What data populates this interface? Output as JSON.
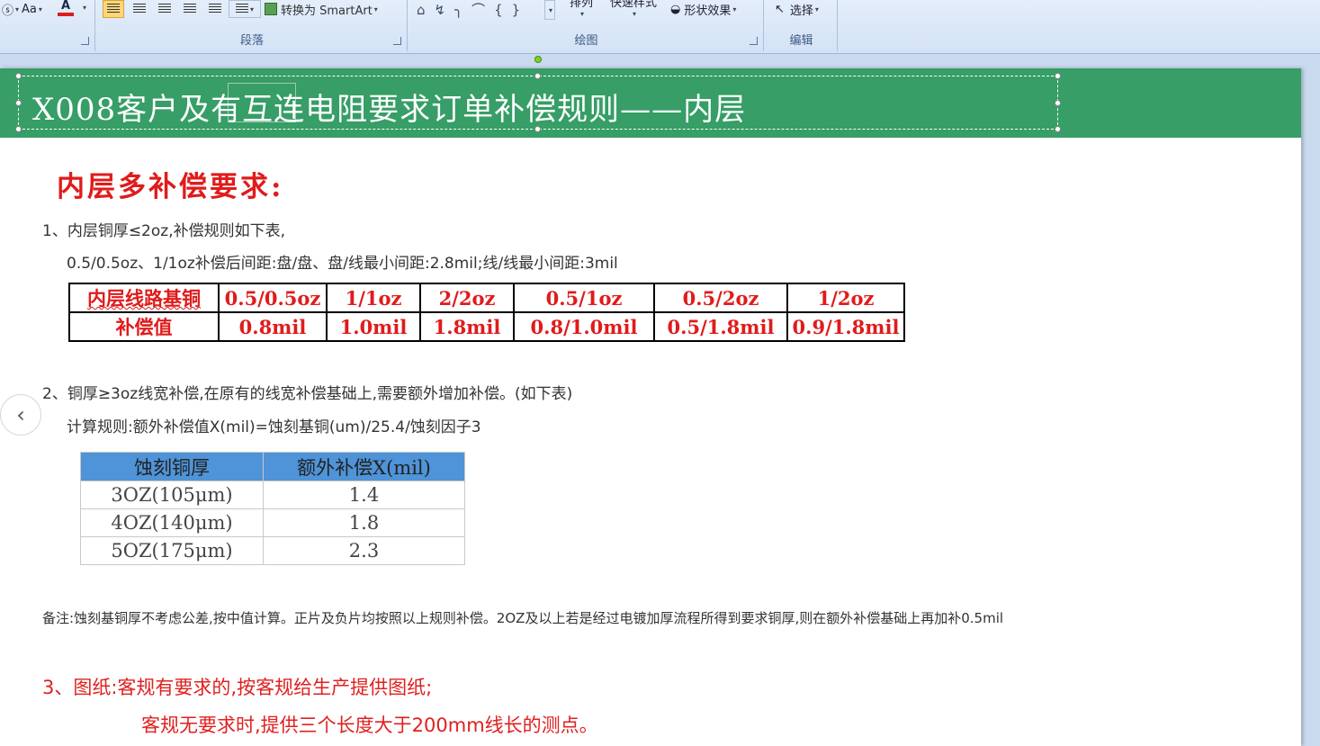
{
  "ribbon": {
    "font_group": {
      "aa_label": "Aa",
      "font_color_label": "A"
    },
    "paragraph_group": {
      "label": "段落",
      "smartart_label": "转换为 SmartArt"
    },
    "drawing_group": {
      "label": "绘图",
      "arrange_label": "排列",
      "quick_styles_label": "快速样式",
      "shape_effects_label": "形状效果"
    },
    "editing_group": {
      "label": "编辑",
      "select_label": "选择"
    }
  },
  "slide": {
    "title": "X008客户及有互连电阻要求订单补偿规则——内层",
    "heading": "内层多补偿要求:",
    "rule1_line1": "1、内层铜厚≤2oz,补偿规则如下表,",
    "rule1_line2": "0.5/0.5oz、1/1oz补偿后间距:盘/盘、盘/线最小间距:2.8mil;线/线最小间距:3mil",
    "table1": {
      "header_label": "内层线路基铜",
      "row_label": "补偿值",
      "columns": [
        "0.5/0.5oz",
        "1/1oz",
        "2/2oz",
        "0.5/1oz",
        "0.5/2oz",
        "1/2oz"
      ],
      "values": [
        "0.8mil",
        "1.0mil",
        "1.8mil",
        "0.8/1.0mil",
        "0.5/1.8mil",
        "0.9/1.8mil"
      ]
    },
    "rule2_line1": "2、铜厚≥3oz线宽补偿,在原有的线宽补偿基础上,需要额外增加补偿。(如下表)",
    "rule2_line2": "计算规则:额外补偿值X(mil)=蚀刻基铜(um)/25.4/蚀刻因子3",
    "table2": {
      "headers": [
        "蚀刻铜厚",
        "额外补偿X(mil)"
      ],
      "rows": [
        [
          "3OZ(105μm)",
          "1.4"
        ],
        [
          "4OZ(140μm)",
          "1.8"
        ],
        [
          "5OZ(175μm)",
          "2.3"
        ]
      ]
    },
    "note": "备注:蚀刻基铜厚不考虑公差,按中值计算。正片及负片均按照以上规则补偿。2OZ及以上若是经过电镀加厚流程所得到要求铜厚,则在额外补偿基础上再加补0.5mil",
    "rule3_line1": "3、图纸:客规有要求的,按客规给生产提供图纸;",
    "rule3_line2": "客规无要求时,提供三个长度大于200mm线长的测点。"
  },
  "colors": {
    "title_bar": "#369e66",
    "red_text": "#e01b1b",
    "table2_header": "#4f93d8"
  }
}
